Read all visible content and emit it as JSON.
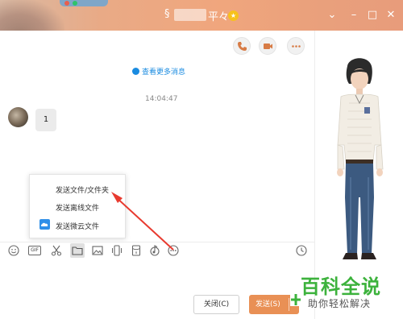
{
  "window": {
    "title_prefix": "§",
    "title_suffix": "平々",
    "badge_glyph": "★",
    "controls": {
      "minimize": "⌄",
      "restore": "–",
      "maximize": "□",
      "close": "✕"
    }
  },
  "actions": [
    "phone-call",
    "video-call",
    "more"
  ],
  "chat": {
    "more_messages": "查看更多消息",
    "timestamp": "14:04:47",
    "messages": [
      {
        "text": "1"
      }
    ]
  },
  "popup_menu": {
    "items": [
      {
        "label": "发送文件/文件夹"
      },
      {
        "label": "发送离线文件"
      },
      {
        "label": "发送微云文件",
        "icon": "weiyun-icon"
      }
    ]
  },
  "toolbar": {
    "gif_label": "GIF",
    "items": [
      "emoji-icon",
      "gif-icon",
      "scissors-icon",
      "folder-icon",
      "image-icon",
      "shake-icon",
      "red-packet-icon",
      "music-icon",
      "more-icon",
      "clock-icon"
    ]
  },
  "buttons": {
    "close": "关闭(C)",
    "send": "发送(S)",
    "send_caret": "▾"
  },
  "watermark": {
    "title": "百科全说",
    "subtitle": "助你轻松解决"
  },
  "colors": {
    "titlebar": "#f0a67d",
    "accent_blue": "#1a8be0",
    "send_button": "#e99055",
    "arrow": "#e83a2f",
    "watermark": "#3cb23c"
  }
}
